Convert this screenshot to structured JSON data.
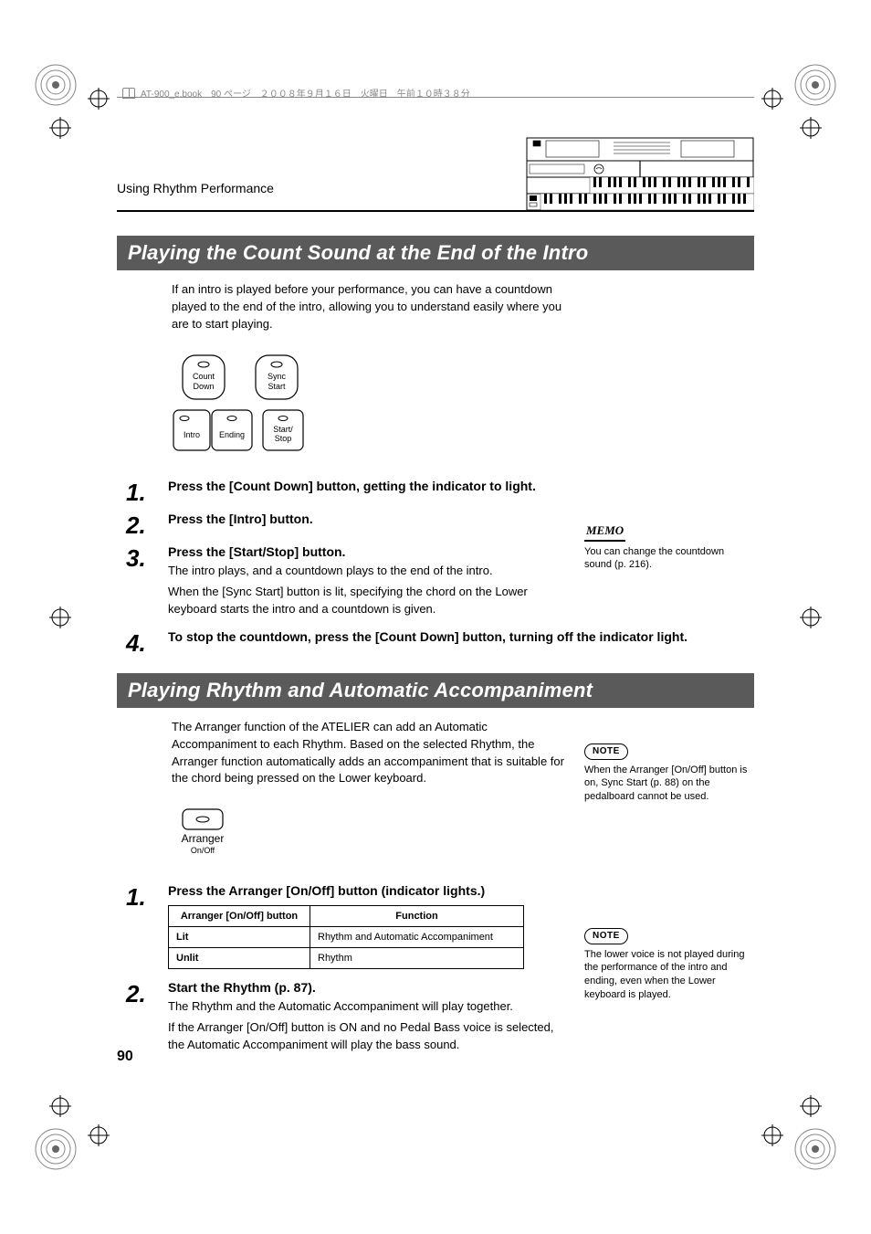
{
  "header": {
    "file_info": "AT-900_e.book　90 ページ　２００８年９月１６日　火曜日　午前１０時３８分"
  },
  "section_label": "Using Rhythm Performance",
  "page_number": "90",
  "section1": {
    "title": "Playing the Count Sound at the End of the Intro",
    "intro": "If an intro is played before your performance, you can have a countdown played to the end of the intro, allowing you to understand easily where you are to start playing.",
    "buttons": {
      "count_down": "Count\nDown",
      "sync_start": "Sync\nStart",
      "intro": "Intro",
      "ending": "Ending",
      "start_stop": "Start/\nStop"
    },
    "steps": [
      {
        "num": "1",
        "title": "Press the [Count Down] button, getting the indicator to light."
      },
      {
        "num": "2",
        "title": "Press the [Intro] button."
      },
      {
        "num": "3",
        "title": "Press the [Start/Stop] button.",
        "lines": [
          "The intro plays, and a countdown plays to the end of the intro.",
          "When the [Sync Start] button is lit, specifying the chord on the Lower keyboard starts the intro and a countdown is given."
        ]
      },
      {
        "num": "4",
        "title": "To stop the countdown, press the [Count Down] button, turning off the indicator light."
      }
    ],
    "memo": {
      "label": "MEMO",
      "text": "You can change the countdown sound (p. 216)."
    }
  },
  "section2": {
    "title": "Playing Rhythm and Automatic Accompaniment",
    "intro": "The Arranger function of the ATELIER can add an Automatic Accompaniment to each Rhythm. Based on the selected Rhythm, the Arranger function automatically adds an accompaniment that is suitable for the chord being pressed on the Lower keyboard.",
    "arranger_label_top": "Arranger",
    "arranger_label_bottom": "On/Off",
    "steps": [
      {
        "num": "1",
        "title": "Press the Arranger [On/Off] button (indicator lights.)"
      },
      {
        "num": "2",
        "title": "Start the Rhythm (p. 87).",
        "lines": [
          "The Rhythm and the Automatic Accompaniment will play together.",
          "If the Arranger [On/Off] button is ON and no Pedal Bass voice is selected, the Automatic Accompaniment will play the bass sound."
        ]
      }
    ],
    "table": {
      "headers": [
        "Arranger [On/Off] button",
        "Function"
      ],
      "rows": [
        [
          "Lit",
          "Rhythm and Automatic Accompaniment"
        ],
        [
          "Unlit",
          "Rhythm"
        ]
      ]
    },
    "notes": [
      {
        "label": "NOTE",
        "text": "When the Arranger [On/Off] button is on, Sync Start (p. 88) on the pedalboard cannot be used."
      },
      {
        "label": "NOTE",
        "text": "The lower voice is not played during the performance of the intro and ending, even when the Lower keyboard is played."
      }
    ]
  }
}
